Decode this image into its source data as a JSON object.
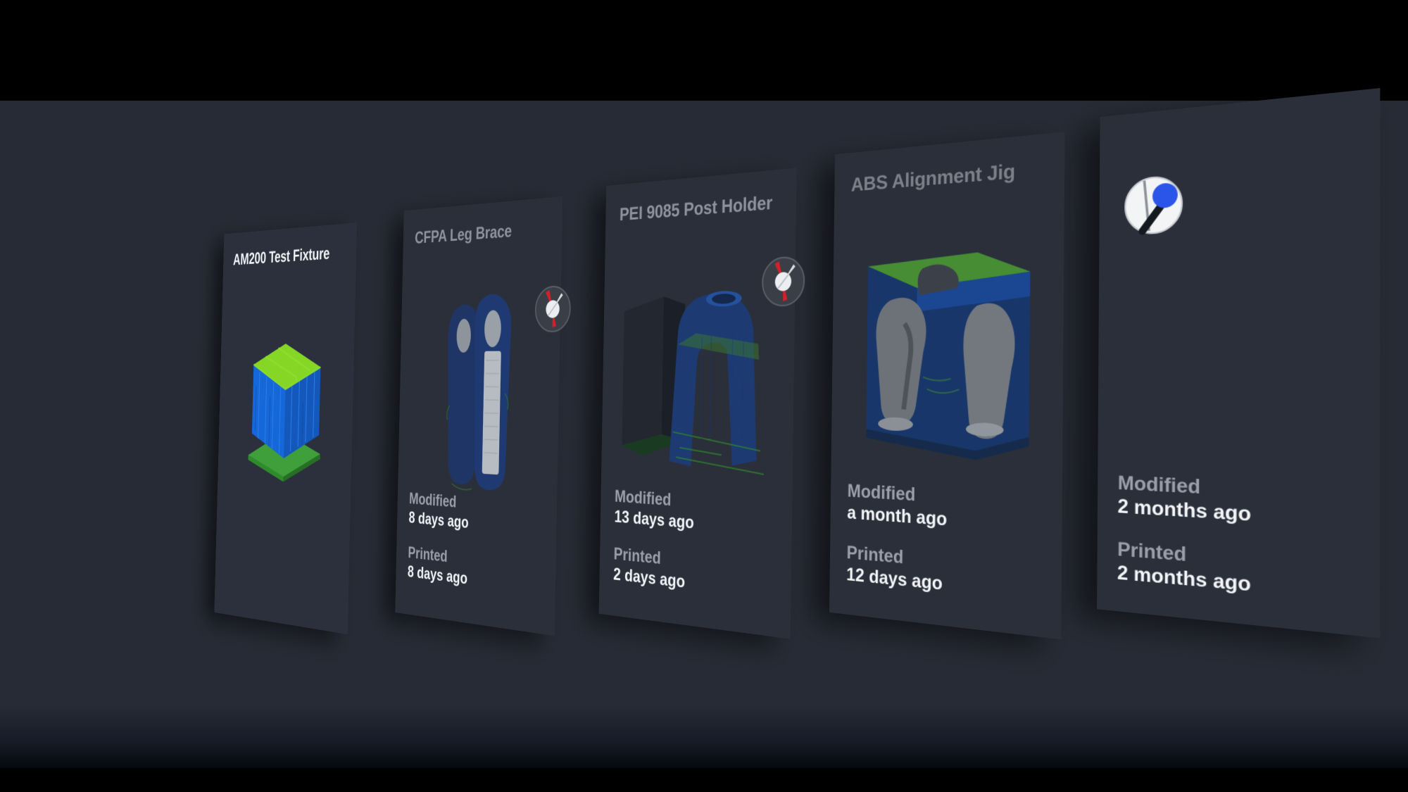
{
  "app": {
    "background_color": "#272b35",
    "card_color": "#2b303c",
    "letterbox_color": "#000000",
    "accent_blue": "#2b54e8",
    "accent_red": "#d4202a",
    "model_blue": "#1c63d6",
    "model_green": "#7fd41f"
  },
  "gallery": {
    "view": "3d-carousel",
    "card_count": 5,
    "meta_labels": {
      "modified": "Modified",
      "printed": "Printed"
    },
    "cards": [
      {
        "title": "AM200 Test Fixture",
        "title_style": "bright",
        "badge": "compass-icon",
        "badge_visible": false,
        "thumbnail": "lattice-block-model",
        "modified_label": "Modified",
        "modified_value": "",
        "printed_label": "Printed",
        "printed_value": "",
        "meta_visible": false
      },
      {
        "title": "CFPA Leg Brace",
        "title_style": "dim",
        "badge": "compass-icon",
        "badge_visible": true,
        "thumbnail": "leg-brace-model",
        "modified_label": "Modified",
        "modified_value": "8 days ago",
        "printed_label": "Printed",
        "printed_value": "8 days ago",
        "meta_visible": true
      },
      {
        "title": "PEI 9085 Post Holder",
        "title_style": "dim",
        "badge": "compass-icon",
        "badge_visible": true,
        "thumbnail": "post-holder-model",
        "modified_label": "Modified",
        "modified_value": "13 days ago",
        "printed_label": "Printed",
        "printed_value": "2 days ago",
        "meta_visible": true
      },
      {
        "title": "ABS Alignment Jig",
        "title_style": "dimmer",
        "badge": "orientation-dot-icon",
        "badge_visible": true,
        "thumbnail": "alignment-jig-model",
        "modified_label": "Modified",
        "modified_value": "a month ago",
        "printed_label": "Printed",
        "printed_value": "12 days ago",
        "meta_visible": true
      },
      {
        "title": "",
        "title_style": "dim",
        "badge": "compass-icon",
        "badge_visible": true,
        "thumbnail": "none",
        "modified_label": "Modified",
        "modified_value": "2 months ago",
        "printed_label": "Printed",
        "printed_value": "2 months ago",
        "meta_visible": true
      }
    ]
  }
}
